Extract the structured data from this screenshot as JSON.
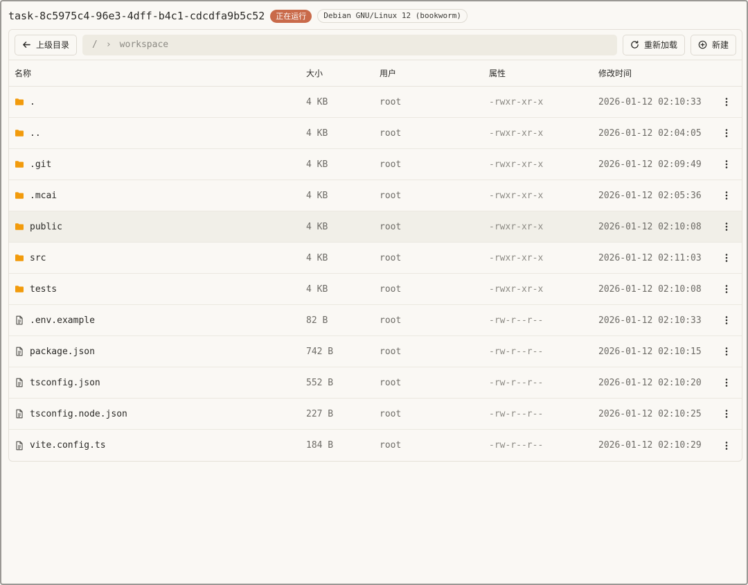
{
  "header": {
    "task_id": "task-8c5975c4-96e3-4dff-b4c1-cdcdfa9b5c52",
    "status": "正在运行",
    "os": "Debian GNU/Linux 12 (bookworm)"
  },
  "toolbar": {
    "back_label": "上级目录",
    "path_root": "/",
    "path_sep": "›",
    "path_current": "workspace",
    "reload_label": "重新加载",
    "new_label": "新建"
  },
  "columns": {
    "name": "名称",
    "size": "大小",
    "user": "用户",
    "perm": "属性",
    "mtime": "修改时间"
  },
  "colors": {
    "folder": "#f29b0c",
    "status_badge": "#c96a4a",
    "path_bg": "#eeebe2"
  },
  "files": [
    {
      "name": ".",
      "type": "folder",
      "size": "4 KB",
      "user": "root",
      "perm": "-rwxr-xr-x",
      "mtime": "2026-01-12 02:10:33"
    },
    {
      "name": "..",
      "type": "folder",
      "size": "4 KB",
      "user": "root",
      "perm": "-rwxr-xr-x",
      "mtime": "2026-01-12 02:04:05"
    },
    {
      "name": ".git",
      "type": "folder",
      "size": "4 KB",
      "user": "root",
      "perm": "-rwxr-xr-x",
      "mtime": "2026-01-12 02:09:49"
    },
    {
      "name": ".mcai",
      "type": "folder",
      "size": "4 KB",
      "user": "root",
      "perm": "-rwxr-xr-x",
      "mtime": "2026-01-12 02:05:36"
    },
    {
      "name": "public",
      "type": "folder",
      "size": "4 KB",
      "user": "root",
      "perm": "-rwxr-xr-x",
      "mtime": "2026-01-12 02:10:08",
      "hover": true
    },
    {
      "name": "src",
      "type": "folder",
      "size": "4 KB",
      "user": "root",
      "perm": "-rwxr-xr-x",
      "mtime": "2026-01-12 02:11:03"
    },
    {
      "name": "tests",
      "type": "folder",
      "size": "4 KB",
      "user": "root",
      "perm": "-rwxr-xr-x",
      "mtime": "2026-01-12 02:10:08"
    },
    {
      "name": ".env.example",
      "type": "file",
      "size": "82 B",
      "user": "root",
      "perm": "-rw-r--r--",
      "mtime": "2026-01-12 02:10:33"
    },
    {
      "name": "package.json",
      "type": "file",
      "size": "742 B",
      "user": "root",
      "perm": "-rw-r--r--",
      "mtime": "2026-01-12 02:10:15"
    },
    {
      "name": "tsconfig.json",
      "type": "file",
      "size": "552 B",
      "user": "root",
      "perm": "-rw-r--r--",
      "mtime": "2026-01-12 02:10:20"
    },
    {
      "name": "tsconfig.node.json",
      "type": "file",
      "size": "227 B",
      "user": "root",
      "perm": "-rw-r--r--",
      "mtime": "2026-01-12 02:10:25"
    },
    {
      "name": "vite.config.ts",
      "type": "file",
      "size": "184 B",
      "user": "root",
      "perm": "-rw-r--r--",
      "mtime": "2026-01-12 02:10:29"
    }
  ]
}
